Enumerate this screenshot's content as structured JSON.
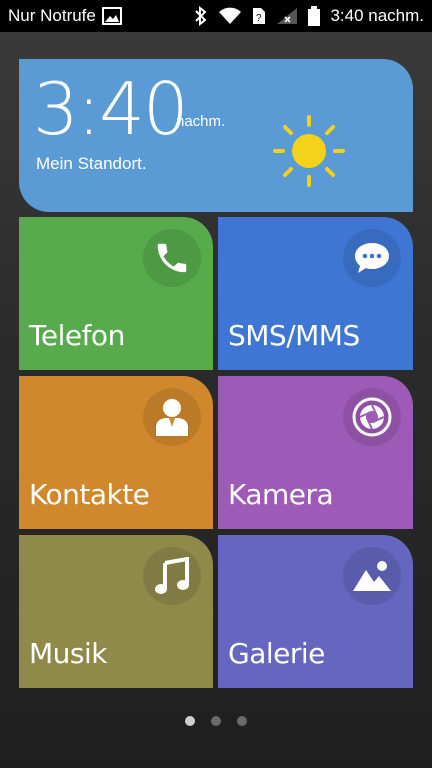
{
  "status_bar": {
    "carrier": "Nur Notrufe",
    "time": "3:40 nachm."
  },
  "clock": {
    "time": "3:40",
    "ampm": "nachm.",
    "location": "Mein Standort.",
    "weather_icon": "sun-icon"
  },
  "tiles": [
    {
      "label": "Telefon",
      "icon": "phone-icon",
      "color": "#57ab4c"
    },
    {
      "label": "SMS/MMS",
      "icon": "chat-bubble-icon",
      "color": "#3f76d4"
    },
    {
      "label": "Kontakte",
      "icon": "contact-icon",
      "color": "#d1882c"
    },
    {
      "label": "Kamera",
      "icon": "camera-aperture-icon",
      "color": "#9d5ab6"
    },
    {
      "label": "Musik",
      "icon": "music-note-icon",
      "color": "#8f8a4a"
    },
    {
      "label": "Galerie",
      "icon": "gallery-icon",
      "color": "#6466bf"
    }
  ],
  "pager": {
    "pages": 3,
    "active": 1
  }
}
